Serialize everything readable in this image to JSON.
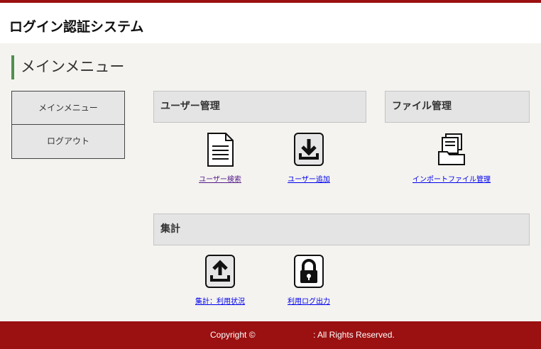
{
  "header": {
    "title": "ログイン認証システム"
  },
  "page": {
    "heading": "メインメニュー"
  },
  "sidebar": {
    "items": [
      {
        "label": "メインメニュー"
      },
      {
        "label": "ログアウト"
      }
    ]
  },
  "sections": {
    "users": {
      "title": "ユーザー管理",
      "links": [
        {
          "label": "ユーザー検索",
          "icon": "document-icon"
        },
        {
          "label": "ユーザー追加",
          "icon": "download-icon"
        }
      ]
    },
    "files": {
      "title": "ファイル管理",
      "links": [
        {
          "label": "インポートファイル管理",
          "icon": "file-tray-icon"
        }
      ]
    },
    "stats": {
      "title": "集計",
      "links": [
        {
          "label": "集計：利用状況",
          "icon": "upload-icon"
        },
        {
          "label": "利用ログ出力",
          "icon": "lock-icon"
        }
      ]
    }
  },
  "footer": {
    "copyright": "Copyright ©",
    "rights": ": All Rights Reserved."
  },
  "colors": {
    "brand": "#9b1010",
    "accent": "#4f8f4f",
    "link": "#0000ee",
    "visited_link": "#551a8b"
  }
}
